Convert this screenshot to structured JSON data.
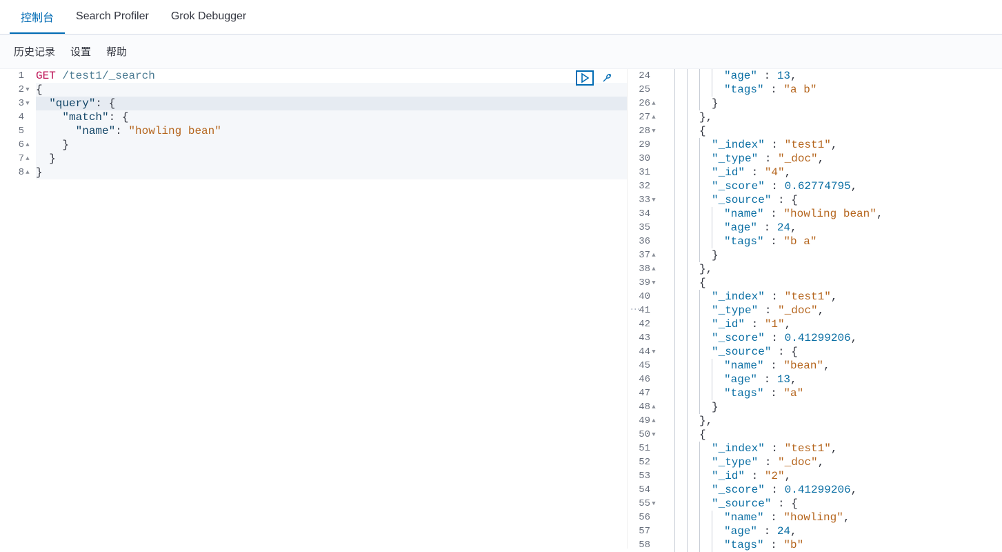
{
  "tabs": [
    {
      "label": "控制台",
      "active": true
    },
    {
      "label": "Search Profiler",
      "active": false
    },
    {
      "label": "Grok Debugger",
      "active": false
    }
  ],
  "subnav": {
    "history": "历史记录",
    "settings": "设置",
    "help": "帮助"
  },
  "request": {
    "method": "GET",
    "path": "/test1/_search",
    "body_lines": [
      "{",
      "  \"query\": {",
      "    \"match\": {",
      "      \"name\": \"howling bean\"",
      "    }",
      "  }",
      "}"
    ]
  },
  "request_line_numbers": [
    1,
    2,
    3,
    4,
    5,
    6,
    7,
    8
  ],
  "response_start_line": 24,
  "response": {
    "lines": [
      {
        "n": 24,
        "indent": 5,
        "text": "\"age\" : 13,",
        "parts": [
          [
            "key",
            "\"age\""
          ],
          [
            "punc",
            " : "
          ],
          [
            "num",
            "13"
          ],
          [
            "punc",
            ","
          ]
        ]
      },
      {
        "n": 25,
        "indent": 5,
        "text": "\"tags\" : \"a b\"",
        "parts": [
          [
            "key",
            "\"tags\""
          ],
          [
            "punc",
            " : "
          ],
          [
            "str",
            "\"a b\""
          ]
        ]
      },
      {
        "n": 26,
        "indent": 4,
        "text": "}",
        "parts": [
          [
            "punc",
            "}"
          ]
        ],
        "fold": "up"
      },
      {
        "n": 27,
        "indent": 3,
        "text": "},",
        "parts": [
          [
            "punc",
            "},"
          ]
        ],
        "fold": "up"
      },
      {
        "n": 28,
        "indent": 3,
        "text": "{",
        "parts": [
          [
            "punc",
            "{"
          ]
        ],
        "fold": "down"
      },
      {
        "n": 29,
        "indent": 4,
        "text": "\"_index\" : \"test1\",",
        "parts": [
          [
            "key",
            "\"_index\""
          ],
          [
            "punc",
            " : "
          ],
          [
            "str",
            "\"test1\""
          ],
          [
            "punc",
            ","
          ]
        ]
      },
      {
        "n": 30,
        "indent": 4,
        "text": "\"_type\" : \"_doc\",",
        "parts": [
          [
            "key",
            "\"_type\""
          ],
          [
            "punc",
            " : "
          ],
          [
            "str",
            "\"_doc\""
          ],
          [
            "punc",
            ","
          ]
        ]
      },
      {
        "n": 31,
        "indent": 4,
        "text": "\"_id\" : \"4\",",
        "parts": [
          [
            "key",
            "\"_id\""
          ],
          [
            "punc",
            " : "
          ],
          [
            "str",
            "\"4\""
          ],
          [
            "punc",
            ","
          ]
        ]
      },
      {
        "n": 32,
        "indent": 4,
        "text": "\"_score\" : 0.62774795,",
        "parts": [
          [
            "key",
            "\"_score\""
          ],
          [
            "punc",
            " : "
          ],
          [
            "num",
            "0.62774795"
          ],
          [
            "punc",
            ","
          ]
        ]
      },
      {
        "n": 33,
        "indent": 4,
        "text": "\"_source\" : {",
        "parts": [
          [
            "key",
            "\"_source\""
          ],
          [
            "punc",
            " : {"
          ]
        ],
        "fold": "down"
      },
      {
        "n": 34,
        "indent": 5,
        "text": "\"name\" : \"howling bean\",",
        "parts": [
          [
            "key",
            "\"name\""
          ],
          [
            "punc",
            " : "
          ],
          [
            "str",
            "\"howling bean\""
          ],
          [
            "punc",
            ","
          ]
        ]
      },
      {
        "n": 35,
        "indent": 5,
        "text": "\"age\" : 24,",
        "parts": [
          [
            "key",
            "\"age\""
          ],
          [
            "punc",
            " : "
          ],
          [
            "num",
            "24"
          ],
          [
            "punc",
            ","
          ]
        ]
      },
      {
        "n": 36,
        "indent": 5,
        "text": "\"tags\" : \"b a\"",
        "parts": [
          [
            "key",
            "\"tags\""
          ],
          [
            "punc",
            " : "
          ],
          [
            "str",
            "\"b a\""
          ]
        ]
      },
      {
        "n": 37,
        "indent": 4,
        "text": "}",
        "parts": [
          [
            "punc",
            "}"
          ]
        ],
        "fold": "up"
      },
      {
        "n": 38,
        "indent": 3,
        "text": "},",
        "parts": [
          [
            "punc",
            "},"
          ]
        ],
        "fold": "up"
      },
      {
        "n": 39,
        "indent": 3,
        "text": "{",
        "parts": [
          [
            "punc",
            "{"
          ]
        ],
        "fold": "down"
      },
      {
        "n": 40,
        "indent": 4,
        "text": "\"_index\" : \"test1\",",
        "parts": [
          [
            "key",
            "\"_index\""
          ],
          [
            "punc",
            " : "
          ],
          [
            "str",
            "\"test1\""
          ],
          [
            "punc",
            ","
          ]
        ]
      },
      {
        "n": 41,
        "indent": 4,
        "text": "\"_type\" : \"_doc\",",
        "parts": [
          [
            "key",
            "\"_type\""
          ],
          [
            "punc",
            " : "
          ],
          [
            "str",
            "\"_doc\""
          ],
          [
            "punc",
            ","
          ]
        ]
      },
      {
        "n": 42,
        "indent": 4,
        "text": "\"_id\" : \"1\",",
        "parts": [
          [
            "key",
            "\"_id\""
          ],
          [
            "punc",
            " : "
          ],
          [
            "str",
            "\"1\""
          ],
          [
            "punc",
            ","
          ]
        ]
      },
      {
        "n": 43,
        "indent": 4,
        "text": "\"_score\" : 0.41299206,",
        "parts": [
          [
            "key",
            "\"_score\""
          ],
          [
            "punc",
            " : "
          ],
          [
            "num",
            "0.41299206"
          ],
          [
            "punc",
            ","
          ]
        ]
      },
      {
        "n": 44,
        "indent": 4,
        "text": "\"_source\" : {",
        "parts": [
          [
            "key",
            "\"_source\""
          ],
          [
            "punc",
            " : {"
          ]
        ],
        "fold": "down"
      },
      {
        "n": 45,
        "indent": 5,
        "text": "\"name\" : \"bean\",",
        "parts": [
          [
            "key",
            "\"name\""
          ],
          [
            "punc",
            " : "
          ],
          [
            "str",
            "\"bean\""
          ],
          [
            "punc",
            ","
          ]
        ]
      },
      {
        "n": 46,
        "indent": 5,
        "text": "\"age\" : 13,",
        "parts": [
          [
            "key",
            "\"age\""
          ],
          [
            "punc",
            " : "
          ],
          [
            "num",
            "13"
          ],
          [
            "punc",
            ","
          ]
        ]
      },
      {
        "n": 47,
        "indent": 5,
        "text": "\"tags\" : \"a\"",
        "parts": [
          [
            "key",
            "\"tags\""
          ],
          [
            "punc",
            " : "
          ],
          [
            "str",
            "\"a\""
          ]
        ]
      },
      {
        "n": 48,
        "indent": 4,
        "text": "}",
        "parts": [
          [
            "punc",
            "}"
          ]
        ],
        "fold": "up"
      },
      {
        "n": 49,
        "indent": 3,
        "text": "},",
        "parts": [
          [
            "punc",
            "},"
          ]
        ],
        "fold": "up"
      },
      {
        "n": 50,
        "indent": 3,
        "text": "{",
        "parts": [
          [
            "punc",
            "{"
          ]
        ],
        "fold": "down"
      },
      {
        "n": 51,
        "indent": 4,
        "text": "\"_index\" : \"test1\",",
        "parts": [
          [
            "key",
            "\"_index\""
          ],
          [
            "punc",
            " : "
          ],
          [
            "str",
            "\"test1\""
          ],
          [
            "punc",
            ","
          ]
        ]
      },
      {
        "n": 52,
        "indent": 4,
        "text": "\"_type\" : \"_doc\",",
        "parts": [
          [
            "key",
            "\"_type\""
          ],
          [
            "punc",
            " : "
          ],
          [
            "str",
            "\"_doc\""
          ],
          [
            "punc",
            ","
          ]
        ]
      },
      {
        "n": 53,
        "indent": 4,
        "text": "\"_id\" : \"2\",",
        "parts": [
          [
            "key",
            "\"_id\""
          ],
          [
            "punc",
            " : "
          ],
          [
            "str",
            "\"2\""
          ],
          [
            "punc",
            ","
          ]
        ]
      },
      {
        "n": 54,
        "indent": 4,
        "text": "\"_score\" : 0.41299206,",
        "parts": [
          [
            "key",
            "\"_score\""
          ],
          [
            "punc",
            " : "
          ],
          [
            "num",
            "0.41299206"
          ],
          [
            "punc",
            ","
          ]
        ]
      },
      {
        "n": 55,
        "indent": 4,
        "text": "\"_source\" : {",
        "parts": [
          [
            "key",
            "\"_source\""
          ],
          [
            "punc",
            " : {"
          ]
        ],
        "fold": "down"
      },
      {
        "n": 56,
        "indent": 5,
        "text": "\"name\" : \"howling\",",
        "parts": [
          [
            "key",
            "\"name\""
          ],
          [
            "punc",
            " : "
          ],
          [
            "str",
            "\"howling\""
          ],
          [
            "punc",
            ","
          ]
        ]
      },
      {
        "n": 57,
        "indent": 5,
        "text": "\"age\" : 24,",
        "parts": [
          [
            "key",
            "\"age\""
          ],
          [
            "punc",
            " : "
          ],
          [
            "num",
            "24"
          ],
          [
            "punc",
            ","
          ]
        ]
      },
      {
        "n": 58,
        "indent": 5,
        "text": "\"tags\" : \"b\"",
        "parts": [
          [
            "key",
            "\"tags\""
          ],
          [
            "punc",
            " : "
          ],
          [
            "str",
            "\"b\""
          ]
        ]
      }
    ]
  },
  "request_fold_markers": {
    "2": "down",
    "3": "down",
    "6": "up",
    "7": "up",
    "8": "up"
  }
}
